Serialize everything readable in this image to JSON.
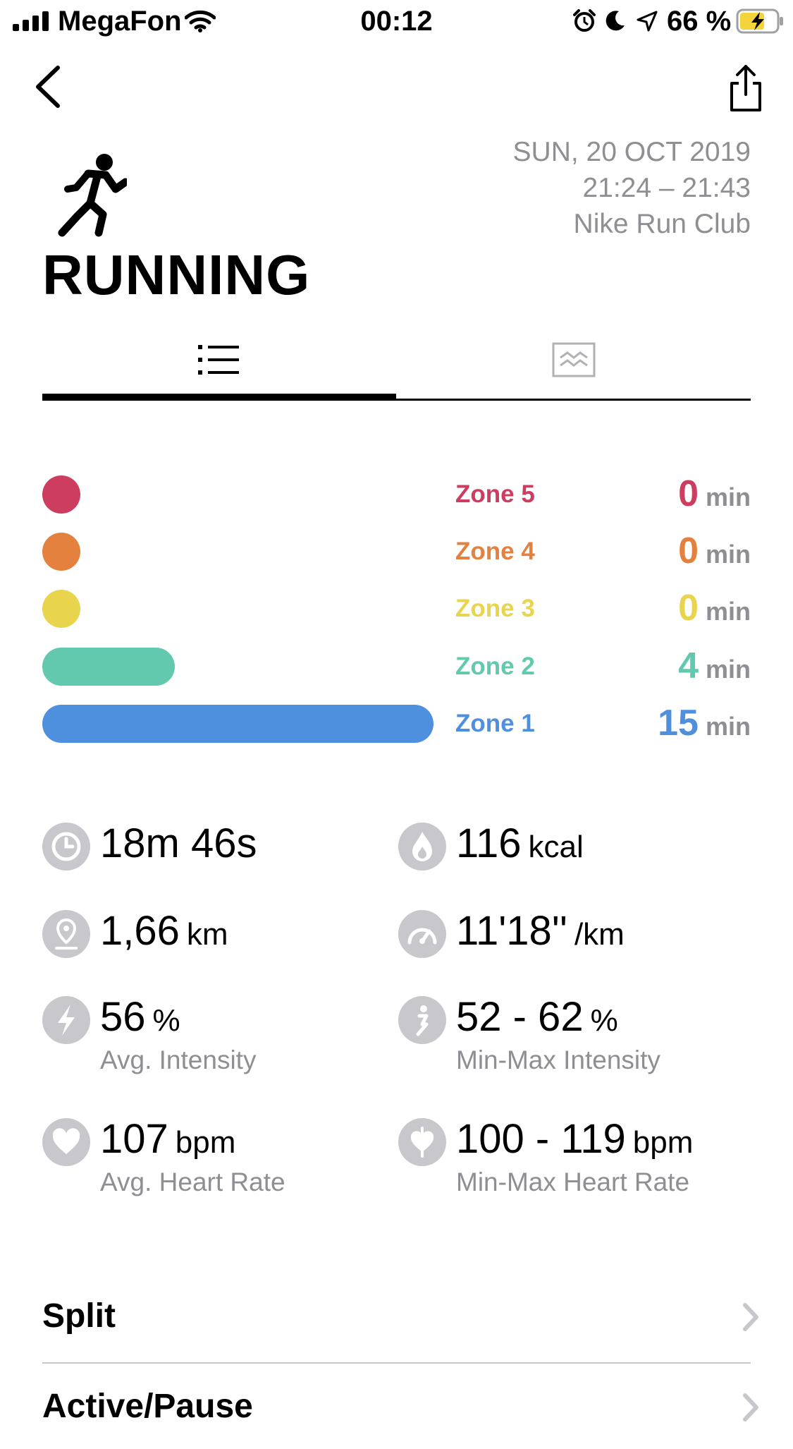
{
  "status_bar": {
    "carrier": "MegaFon",
    "time": "00:12",
    "battery_percent": "66 %",
    "signal_icon": "signal-bars-icon",
    "wifi_icon": "wifi-icon",
    "alarm_icon": "alarm-icon",
    "moon_icon": "moon-icon",
    "location_icon": "location-arrow-icon",
    "battery_icon": "battery-charging-icon"
  },
  "nav": {
    "back_icon": "chevron-left-icon",
    "share_icon": "share-icon"
  },
  "header": {
    "activity_icon": "running-person-icon",
    "title": "RUNNING",
    "date": "SUN, 20 OCT 2019",
    "time_range": "21:24 – 21:43",
    "source": "Nike Run Club"
  },
  "tabs": [
    {
      "icon": "list-icon",
      "active": true
    },
    {
      "icon": "chart-icon",
      "active": false
    }
  ],
  "zones": [
    {
      "label": "Zone 5",
      "value": "0",
      "unit": "min",
      "color": "#cc3d5f",
      "bar_fraction": 0
    },
    {
      "label": "Zone 4",
      "value": "0",
      "unit": "min",
      "color": "#e5813f",
      "bar_fraction": 0
    },
    {
      "label": "Zone 3",
      "value": "0",
      "unit": "min",
      "color": "#e8d44d",
      "bar_fraction": 0
    },
    {
      "label": "Zone 2",
      "value": "4",
      "unit": "min",
      "color": "#63c9ae",
      "bar_fraction": 0.267
    },
    {
      "label": "Zone 1",
      "value": "15",
      "unit": "min",
      "color": "#4e8fde",
      "bar_fraction": 1.0
    }
  ],
  "stats": [
    {
      "icon": "clock-icon",
      "value": "18m 46s",
      "unit": "",
      "sublabel": ""
    },
    {
      "icon": "flame-icon",
      "value": "116",
      "unit": "kcal",
      "sublabel": ""
    },
    {
      "icon": "location-pin-icon",
      "value": "1,66",
      "unit": "km",
      "sublabel": ""
    },
    {
      "icon": "speedometer-icon",
      "value": "11'18''",
      "unit": "/km",
      "sublabel": ""
    },
    {
      "icon": "lightning-icon",
      "value": "56",
      "unit": "%",
      "sublabel": "Avg. Intensity"
    },
    {
      "icon": "intensity-range-icon",
      "value": "52 - 62",
      "unit": "%",
      "sublabel": "Min-Max Intensity"
    },
    {
      "icon": "heart-icon",
      "value": "107",
      "unit": "bpm",
      "sublabel": "Avg. Heart Rate"
    },
    {
      "icon": "heart-range-icon",
      "value": "100 - 119",
      "unit": "bpm",
      "sublabel": "Min-Max Heart Rate"
    }
  ],
  "list": [
    {
      "label": "Split",
      "icon": "chevron-right-icon"
    },
    {
      "label": "Active/Pause",
      "icon": "chevron-right-icon"
    }
  ],
  "colors": {
    "text_secondary": "#8e8e93",
    "icon_bg": "#c7c7cc",
    "battery_fill": "#f5d33b"
  }
}
